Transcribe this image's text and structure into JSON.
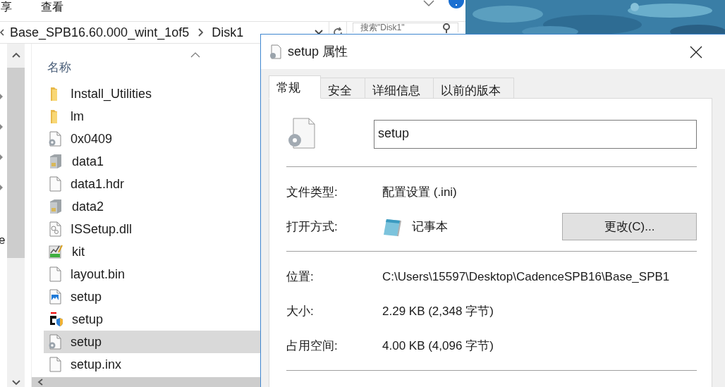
{
  "explorer": {
    "ribbon_tabs": [
      "享",
      "查看"
    ],
    "breadcrumb": [
      "Base_SPB16.60.000_wint_1of5",
      "Disk1"
    ],
    "search": {
      "placeholder": "搜索\"Disk1\""
    },
    "nav_pane_text": "e",
    "column_header": "名称",
    "files": [
      {
        "name": "Install_Utilities",
        "kind": "folder",
        "selected": false
      },
      {
        "name": "lm",
        "kind": "folder",
        "selected": false
      },
      {
        "name": "0x0409",
        "kind": "config",
        "selected": false
      },
      {
        "name": "data1",
        "kind": "archive",
        "selected": false
      },
      {
        "name": "data1.hdr",
        "kind": "blank",
        "selected": false
      },
      {
        "name": "data2",
        "kind": "archive",
        "selected": false
      },
      {
        "name": "ISSetup.dll",
        "kind": "dll",
        "selected": false
      },
      {
        "name": "kit",
        "kind": "chart",
        "selected": false
      },
      {
        "name": "layout.bin",
        "kind": "blank",
        "selected": false
      },
      {
        "name": "setup",
        "selected": false
      },
      {
        "name": "setup",
        "kind": "installer",
        "selected": false
      },
      {
        "name": "setup",
        "kind": "config",
        "selected": true
      },
      {
        "name": "setup.inx",
        "kind": "blank",
        "selected": false
      }
    ]
  },
  "dialog": {
    "title": "setup 属性",
    "tabs": [
      {
        "label": "常规",
        "selected": true
      },
      {
        "label": "安全",
        "selected": false
      },
      {
        "label": "详细信息",
        "selected": false
      },
      {
        "label": "以前的版本",
        "selected": false
      }
    ],
    "file_name": "setup",
    "sections": [
      [
        {
          "kind": "text",
          "label": "文件类型:",
          "value": "配置设置 (.ini)"
        },
        {
          "kind": "open_with",
          "label": "打开方式:",
          "value": "记事本",
          "button": "更改(C)..."
        }
      ],
      [
        {
          "kind": "text",
          "label": "位置:",
          "value": "C:\\Users\\15597\\Desktop\\CadenceSPB16\\Base_SPB1"
        },
        {
          "kind": "text",
          "label": "大小:",
          "value": "2.29 KB (2,348 字节)"
        },
        {
          "kind": "text",
          "label": "占用空间:",
          "value": "4.00 KB (4,096 字节)"
        }
      ]
    ]
  }
}
